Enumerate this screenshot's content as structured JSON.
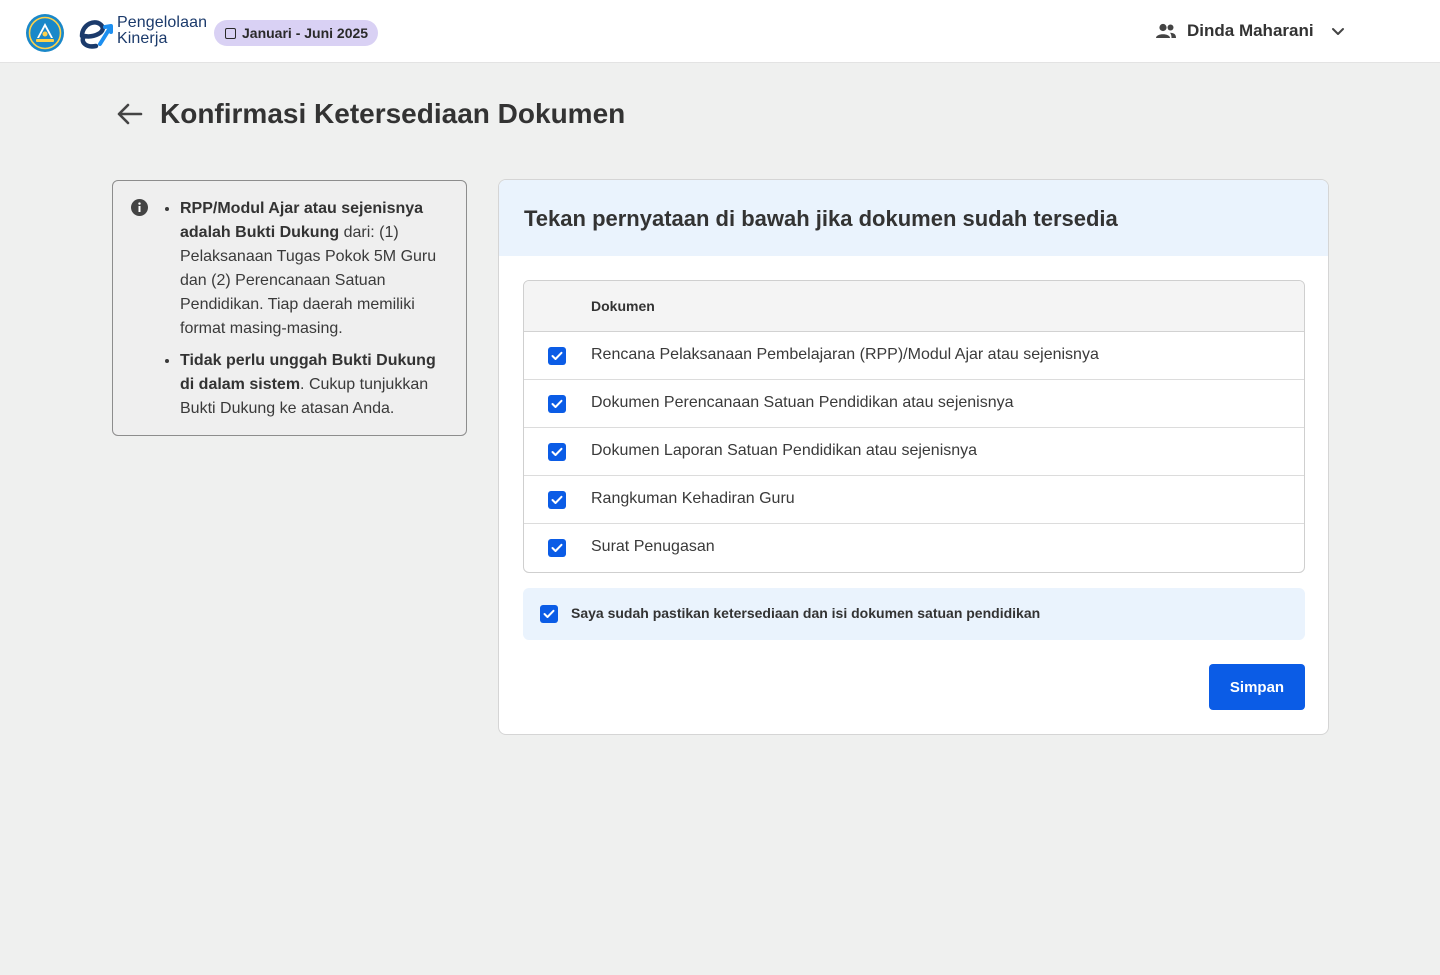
{
  "header": {
    "app_name_line1": "Pengelolaan",
    "app_name_line2": "Kinerja",
    "period": "Januari - Juni 2025",
    "user_name": "Dinda Maharani",
    "brand_color": "#1b3a6b",
    "chip_color": "#d9d1f4"
  },
  "page": {
    "title": "Konfirmasi Ketersediaan Dokumen"
  },
  "info": {
    "item1_bold": "RPP/Modul Ajar atau sejenisnya adalah Bukti Dukung",
    "item1_text": " dari: (1) Pelaksanaan Tugas Pokok 5M Guru dan (2) Perencanaan Satuan Pendidikan. Tiap daerah memiliki format masing-masing.",
    "item2_bold": "Tidak perlu unggah Bukti Dukung di dalam sistem",
    "item2_text": ". Cukup tunjukkan Bukti Dukung ke atasan Anda."
  },
  "card": {
    "title": "Tekan pernyataan di bawah jika dokumen sudah tersedia",
    "table_header": "Dokumen",
    "documents": [
      {
        "label": "Rencana Pelaksanaan Pembelajaran (RPP)/Modul Ajar atau sejenisnya",
        "checked": true
      },
      {
        "label": "Dokumen Perencanaan Satuan Pendidikan atau sejenisnya",
        "checked": true
      },
      {
        "label": "Dokumen Laporan Satuan Pendidikan atau sejenisnya",
        "checked": true
      },
      {
        "label": "Rangkuman Kehadiran Guru",
        "checked": true
      },
      {
        "label": "Surat Penugasan",
        "checked": true
      }
    ],
    "confirmation": {
      "label": "Saya sudah pastikan ketersediaan dan isi dokumen satuan pendidikan",
      "checked": true
    },
    "save_label": "Simpan",
    "accent_color": "#0b5ce6"
  }
}
